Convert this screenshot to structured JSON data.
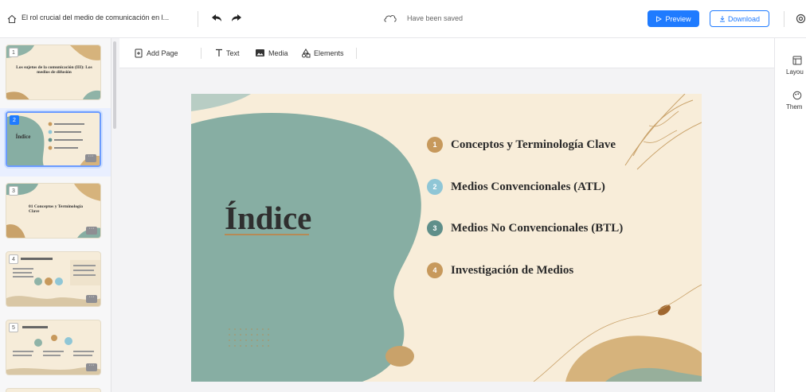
{
  "topbar": {
    "doc_title": "El rol crucial del medio de comunicación en l...",
    "save_status": "Have been saved",
    "preview_label": "Preview",
    "download_label": "Download"
  },
  "toolbar": {
    "add_page": "Add Page",
    "text": "Text",
    "media": "Media",
    "elements": "Elements"
  },
  "right_panel": {
    "layout": "Layou",
    "theme": "Them"
  },
  "slides": [
    {
      "num": "1",
      "title": "Los sujetos de la comunicación (III): Los medios de difusión"
    },
    {
      "num": "2",
      "title": "Índice"
    },
    {
      "num": "3",
      "title": "01 Conceptos y Terminología Clave"
    },
    {
      "num": "4",
      "title": ""
    },
    {
      "num": "5",
      "title": ""
    }
  ],
  "canvas": {
    "title": "Índice",
    "items": [
      {
        "num": "1",
        "label": "Conceptos y Terminología Clave",
        "color": "#c7995c"
      },
      {
        "num": "2",
        "label": "Medios Convencionales (ATL)",
        "color": "#8fc6d6"
      },
      {
        "num": "3",
        "label": "Medios No Convencionales (BTL)",
        "color": "#5f8f8a"
      },
      {
        "num": "4",
        "label": "Investigación de Medios",
        "color": "#c7995c"
      }
    ]
  },
  "colors": {
    "accent": "#1f7bff",
    "slide_bg": "#f8edd9",
    "teal": "#87aea3",
    "gold": "#c7995c"
  }
}
